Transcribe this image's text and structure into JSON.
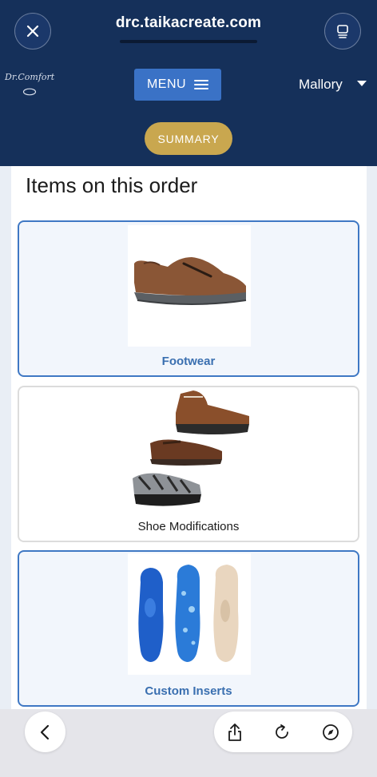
{
  "browser": {
    "url": "drc.taikacreate.com",
    "close_icon": "close-icon",
    "tabs_icon": "tabs-icon"
  },
  "header": {
    "brand": "Dr.Comfort",
    "menu_label": "MENU",
    "user_name": "Mallory",
    "summary_label": "SUMMARY"
  },
  "main": {
    "heading": "Items on this order",
    "items": [
      {
        "label": "Footwear",
        "selected": true,
        "image": "slip-on-brown-shoe"
      },
      {
        "label": "Shoe Modifications",
        "selected": false,
        "image": "modified-shoes-stack"
      },
      {
        "label": "Custom Inserts",
        "selected": true,
        "image": "insoles"
      }
    ]
  },
  "toolbar": {
    "back_icon": "back-chevron-icon",
    "share_icon": "share-icon",
    "reload_icon": "reload-icon",
    "compass_icon": "compass-icon"
  },
  "colors": {
    "header_bg": "#15305a",
    "menu_button": "#3a72c6",
    "summary_button": "#c9a74f",
    "selected_border": "#3f78c4",
    "label_blue": "#3a6fb0"
  }
}
